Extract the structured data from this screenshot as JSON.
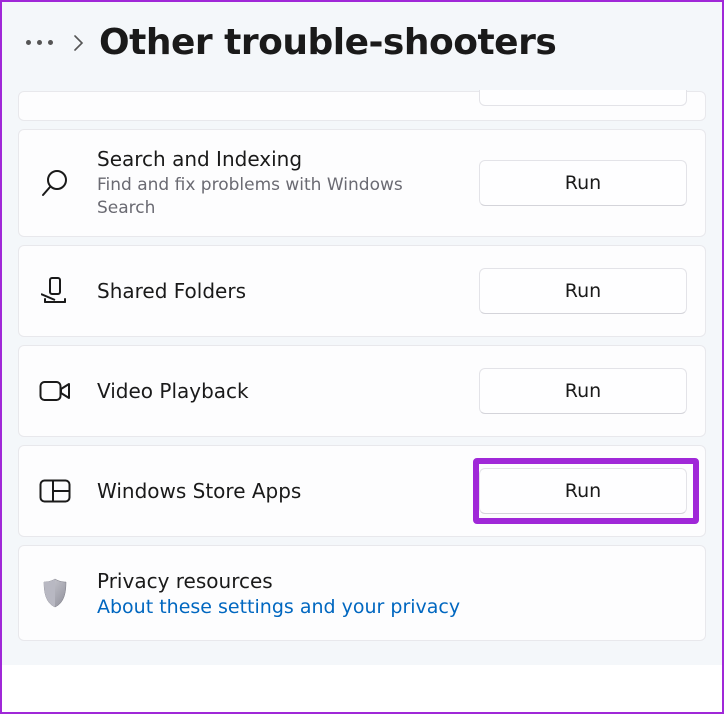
{
  "header": {
    "title": "Other trouble-shooters"
  },
  "items": [
    {
      "title": "Search and Indexing",
      "subtitle": "Find and fix problems with Windows Search",
      "button": "Run"
    },
    {
      "title": "Shared Folders",
      "subtitle": "",
      "button": "Run"
    },
    {
      "title": "Video Playback",
      "subtitle": "",
      "button": "Run"
    },
    {
      "title": "Windows Store Apps",
      "subtitle": "",
      "button": "Run"
    }
  ],
  "privacy": {
    "title": "Privacy resources",
    "link": "About these settings and your privacy"
  }
}
